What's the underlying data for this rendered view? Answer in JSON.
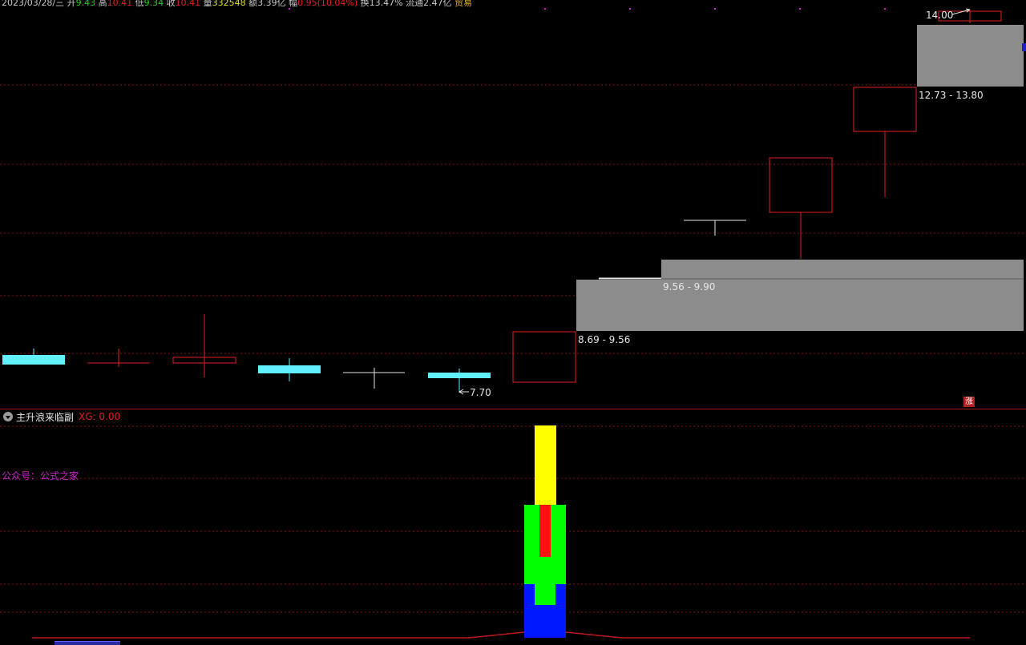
{
  "status_bar": {
    "items": [
      {
        "text": "2023/03/28/三",
        "color": "#c8c8c8"
      },
      {
        "text": " 开",
        "color": "#c8c8c8"
      },
      {
        "text": "9.43",
        "color": "#20d020"
      },
      {
        "text": " 高",
        "color": "#c8c8c8"
      },
      {
        "text": "10.41",
        "color": "#e02020"
      },
      {
        "text": " 低",
        "color": "#c8c8c8"
      },
      {
        "text": "9.34",
        "color": "#20d020"
      },
      {
        "text": " 收",
        "color": "#c8c8c8"
      },
      {
        "text": "10.41",
        "color": "#e02020"
      },
      {
        "text": " 量",
        "color": "#c8c8c8"
      },
      {
        "text": "332548",
        "color": "#e0e020"
      },
      {
        "text": " 额",
        "color": "#c8c8c8"
      },
      {
        "text": "3.39亿",
        "color": "#c8c8c8"
      },
      {
        "text": " 幅",
        "color": "#c8c8c8"
      },
      {
        "text": "0.95(10.04%)",
        "color": "#e02020"
      },
      {
        "text": " 换",
        "color": "#c8c8c8"
      },
      {
        "text": "13.47%",
        "color": "#c8c8c8"
      },
      {
        "text": " 流通",
        "color": "#c8c8c8"
      },
      {
        "text": "2.47亿",
        "color": "#c8c8c8"
      },
      {
        "text": " 贸易",
        "color": "#e0b020"
      }
    ]
  },
  "kline": {
    "colors": {
      "up": "#e02020",
      "down": "#60f0ff",
      "doji": "#e6e6e6",
      "gap_zone": "#8c8c8c",
      "gridline": "#8a1010"
    },
    "candles": [
      {
        "type": "down"
      },
      {
        "type": "up"
      },
      {
        "type": "up"
      },
      {
        "type": "down"
      },
      {
        "type": "doji"
      },
      {
        "type": "down"
      },
      {
        "type": "up"
      },
      {
        "type": "doji"
      },
      {
        "type": "doji"
      },
      {
        "type": "up"
      },
      {
        "type": "up"
      },
      {
        "type": "up"
      },
      {
        "type": "up"
      }
    ],
    "gap_zones": [
      {
        "label": "8.69 - 9.56"
      },
      {
        "label": "9.56 - 9.90"
      },
      {
        "label": "12.73 - 13.80"
      }
    ],
    "annotations": {
      "low_marker": "7.70",
      "high_marker": "14.00"
    }
  },
  "indicator": {
    "name": "主升浪来临副",
    "value_label": "XG: 0.00",
    "watermark": "公众号：公式之家",
    "rise_badge": "涨",
    "colors": {
      "yellow": "#ffff00",
      "green": "#00ff00",
      "red": "#ff1010",
      "blue": "#0018ff",
      "baseline": "#c01818"
    }
  }
}
